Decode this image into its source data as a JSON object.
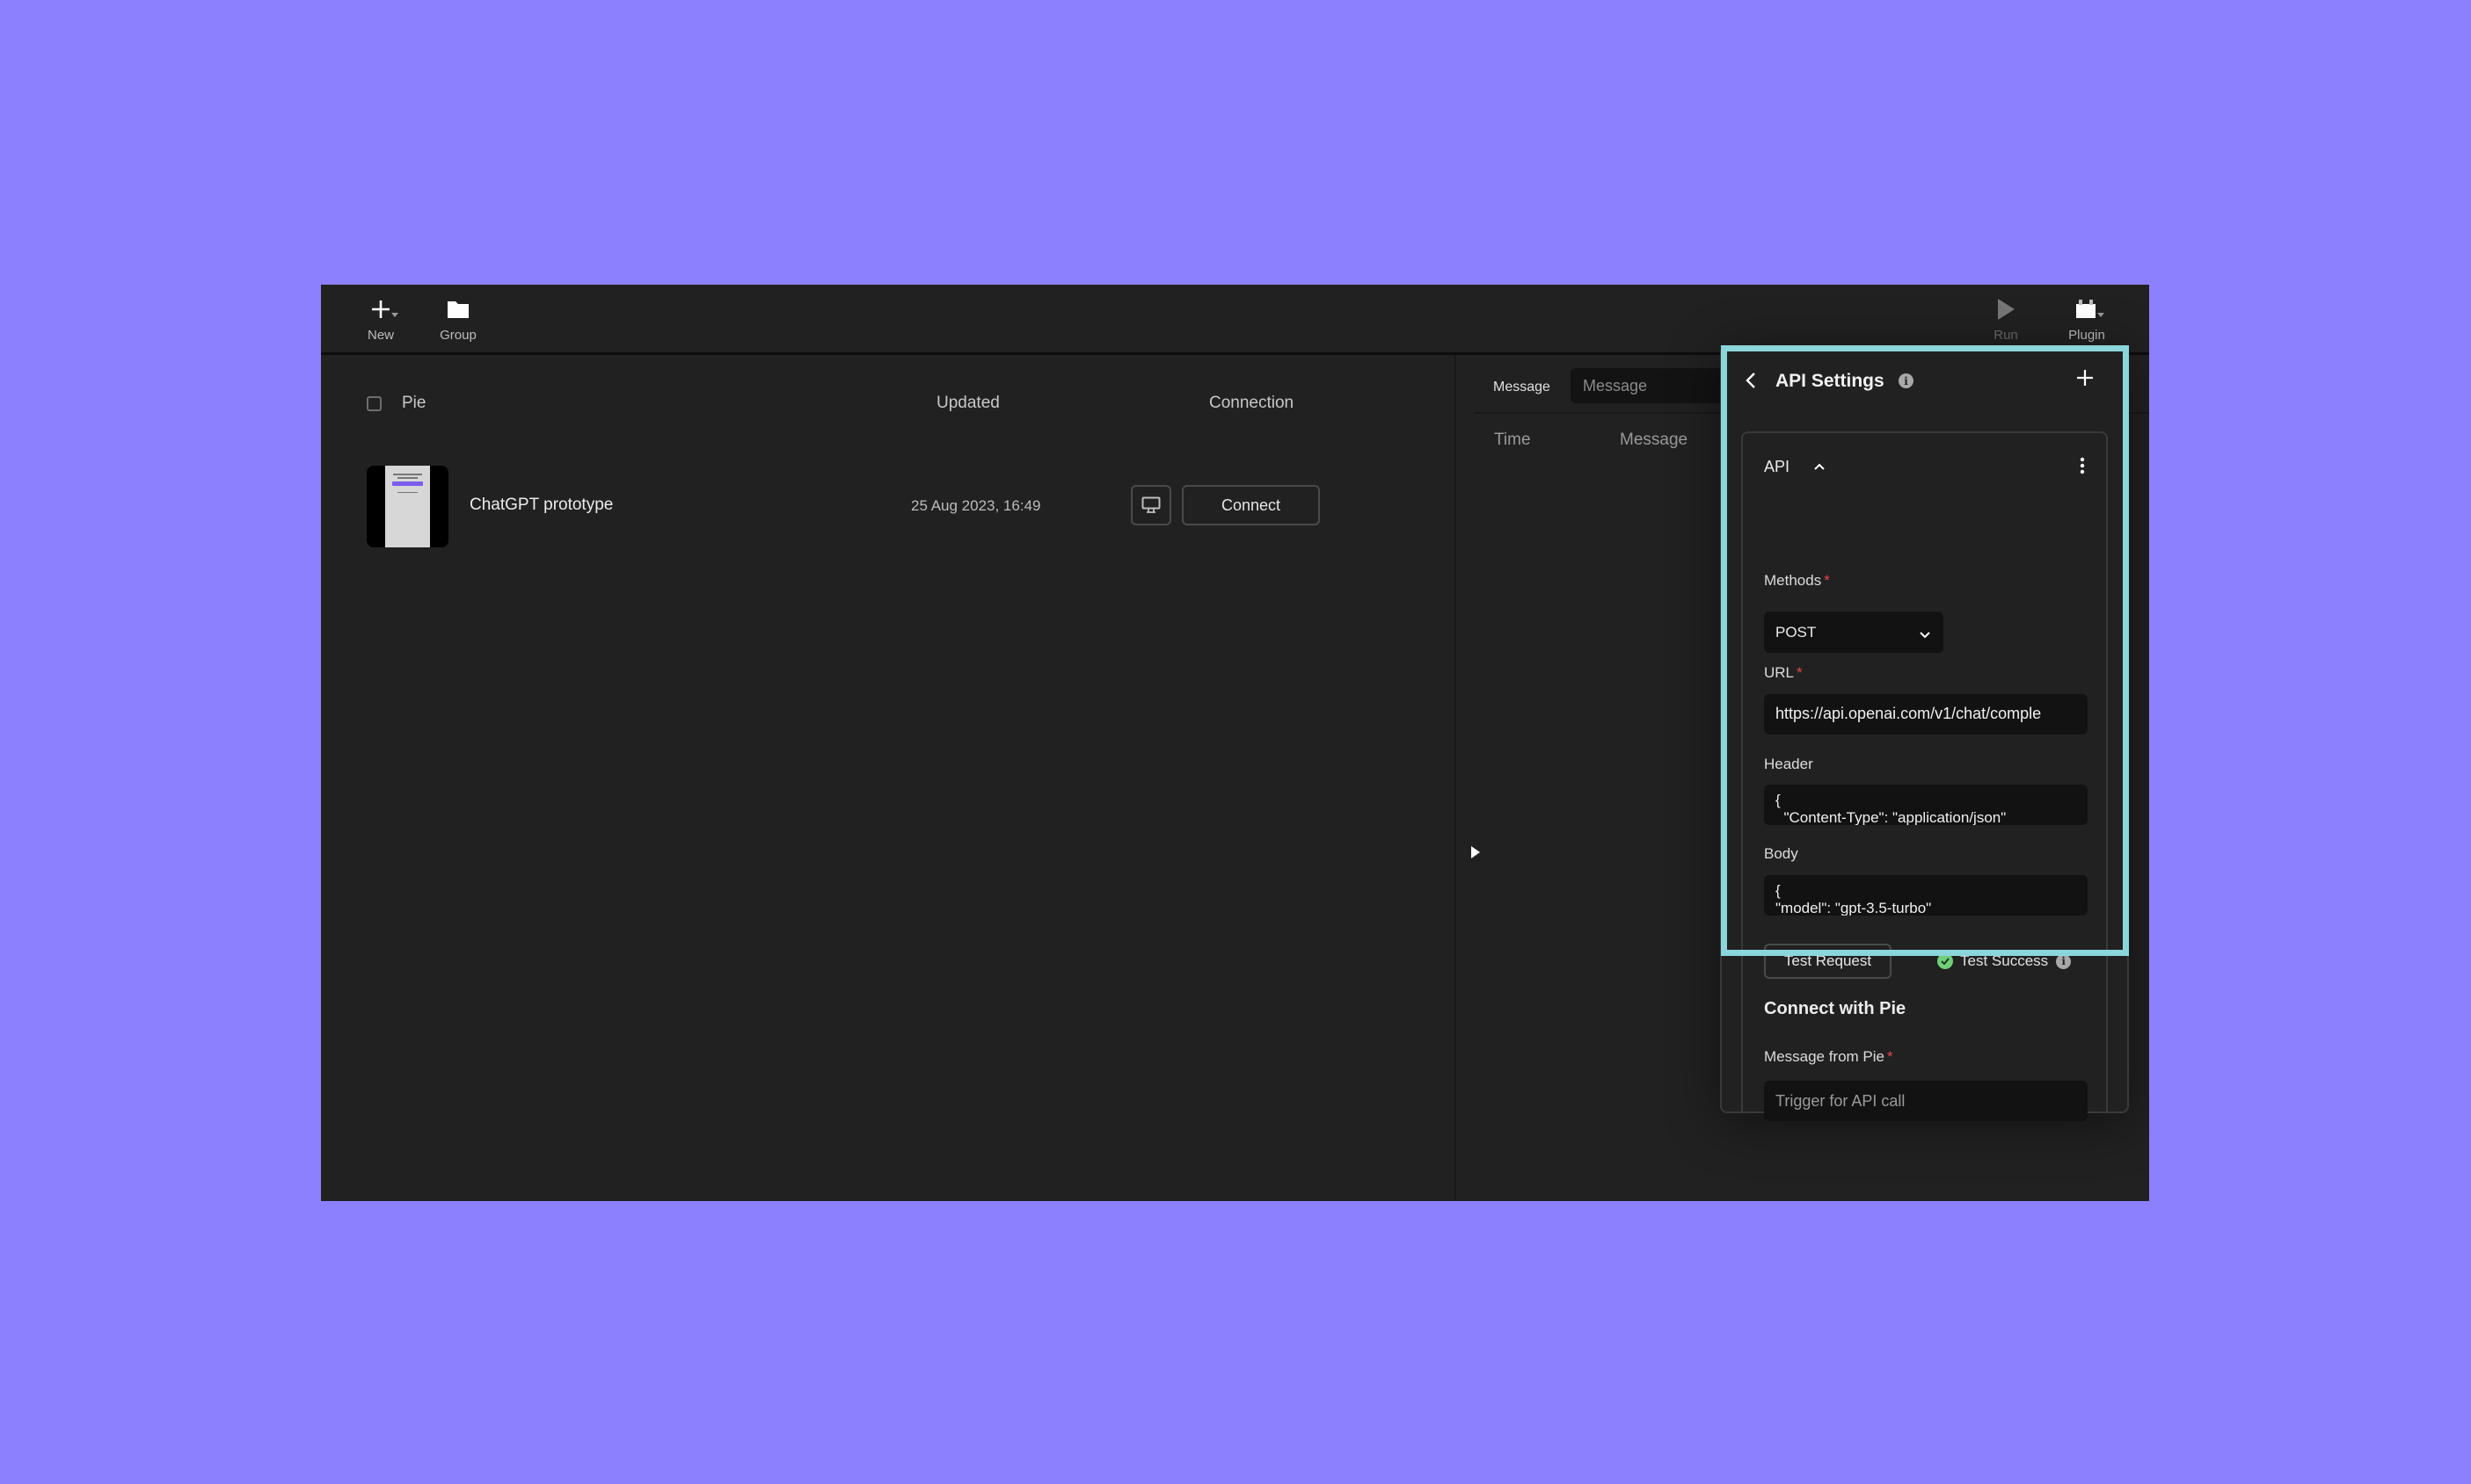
{
  "toolbar": {
    "new_label": "New",
    "group_label": "Group",
    "run_label": "Run",
    "plugin_label": "Plugin",
    "icons": {
      "new": "plus-icon",
      "group": "folder-icon",
      "run": "play-icon",
      "plugin": "plugin-icon"
    }
  },
  "list": {
    "columns": {
      "pie": "Pie",
      "updated": "Updated",
      "connection": "Connection"
    },
    "rows": [
      {
        "title": "ChatGPT prototype",
        "updated": "25 Aug 2023, 16:49",
        "connect_label": "Connect"
      }
    ]
  },
  "messages": {
    "filter_label": "Message",
    "filter_placeholder": "Message",
    "columns": {
      "time": "Time",
      "message": "Message"
    }
  },
  "api_settings": {
    "title": "API Settings",
    "card_title": "API",
    "methods_label": "Methods",
    "method_value": "POST",
    "url_label": "URL",
    "url_value": "https://api.openai.com/v1/chat/comple",
    "header_label": "Header",
    "header_value": "{\n  \"Content-Type\": \"application/json\"",
    "body_label": "Body",
    "body_value": "{\n\"model\": \"gpt-3.5-turbo\"",
    "test_request_label": "Test Request",
    "test_status": "Test Success",
    "required_mark": "*",
    "connect_section_title": "Connect with Pie",
    "message_from_pie_label": "Message from Pie",
    "message_from_pie_placeholder": "Trigger for API call"
  },
  "colors": {
    "background": "#8d80fe",
    "app_bg": "#212121",
    "highlight": "#8ad6da",
    "success": "#6fcf7a",
    "required": "#e5484d"
  }
}
